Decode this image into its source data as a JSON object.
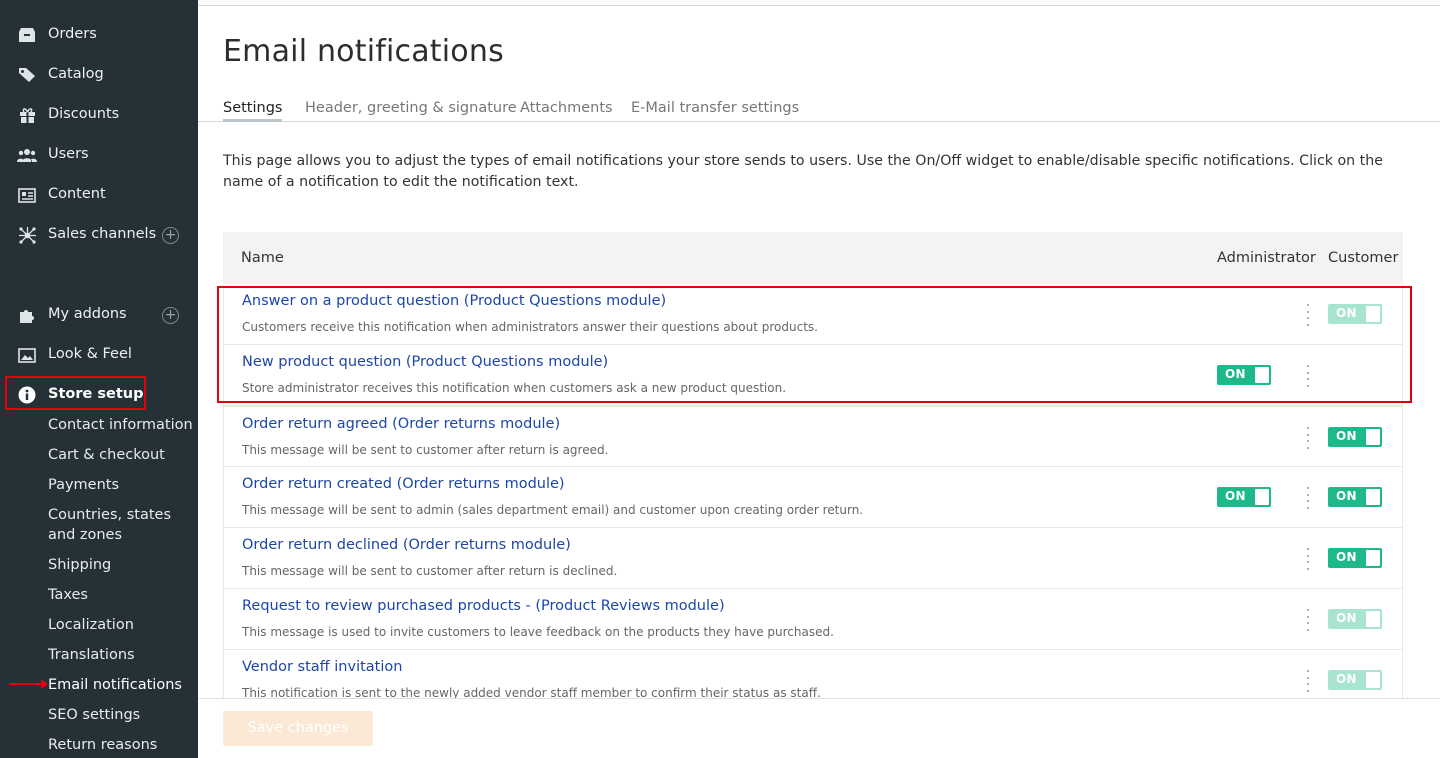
{
  "sidebar": {
    "items": [
      {
        "label": "Orders",
        "icon": "orders-icon"
      },
      {
        "label": "Catalog",
        "icon": "catalog-icon"
      },
      {
        "label": "Discounts",
        "icon": "gift-icon"
      },
      {
        "label": "Users",
        "icon": "users-icon"
      },
      {
        "label": "Content",
        "icon": "content-icon"
      },
      {
        "label": "Sales channels",
        "icon": "network-icon"
      },
      {
        "label": "My addons",
        "icon": "puzzle-icon"
      },
      {
        "label": "Look & Feel",
        "icon": "image-icon"
      },
      {
        "label": "Store setup",
        "icon": "info-icon"
      }
    ],
    "store_setup_sub": [
      "Contact information",
      "Cart & checkout",
      "Payments",
      "Countries, states and zones",
      "Shipping",
      "Taxes",
      "Localization",
      "Translations",
      "Email notifications",
      "SEO settings",
      "Return reasons"
    ]
  },
  "page": {
    "title": "Email notifications",
    "tabs": [
      "Settings",
      "Header, greeting & signature",
      "Attachments",
      "E-Mail transfer settings"
    ],
    "description": "This page allows you to adjust the types of email notifications your store sends to users. Use the On/Off widget to enable/disable specific notifications. Click on the name of a notification to edit the notification text."
  },
  "table": {
    "headers": {
      "name": "Name",
      "admin": "Administrator",
      "customer": "Customer"
    },
    "toggle_label": "ON",
    "rows": [
      {
        "title": "Answer on a product question (Product Questions module)",
        "desc": "Customers receive this notification when administrators answer their questions about products."
      },
      {
        "title": "New product question (Product Questions module)",
        "desc": "Store administrator receives this notification when customers ask a new product question."
      },
      {
        "title": "Order return agreed (Order returns module)",
        "desc": "This message will be sent to customer after return is agreed."
      },
      {
        "title": "Order return created (Order returns module)",
        "desc": "This message will be sent to admin (sales department email) and customer upon creating order return."
      },
      {
        "title": "Order return declined (Order returns module)",
        "desc": "This message will be sent to customer after return is declined."
      },
      {
        "title": "Request to review purchased products - (Product Reviews module)",
        "desc": "This message is used to invite customers to leave feedback on the products they have purchased."
      },
      {
        "title": "Vendor staff invitation",
        "desc": "This notification is sent to the newly added vendor staff member to confirm their status as staff."
      }
    ]
  },
  "footer": {
    "save_label": "Save changes"
  },
  "colors": {
    "sidebar_bg": "#253037",
    "toggle_on": "#1eb98b",
    "link": "#1c46a8",
    "highlight": "#e3000f"
  }
}
